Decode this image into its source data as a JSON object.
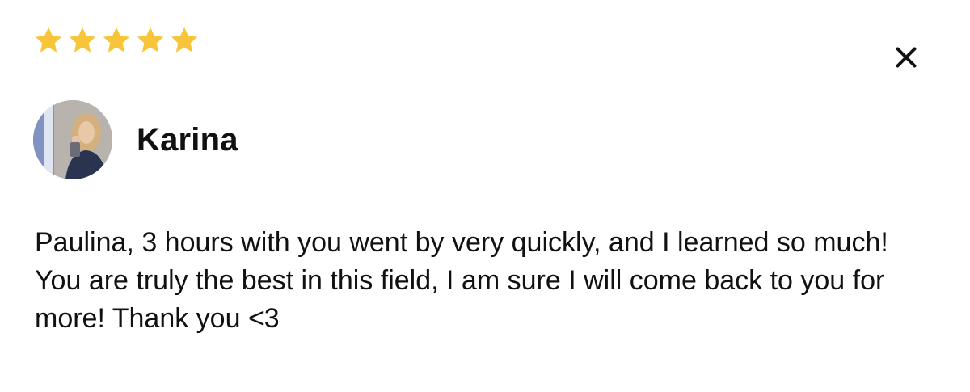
{
  "rating": {
    "stars": 5,
    "max": 5,
    "star_color": "#F8C53A",
    "icon": "star-icon"
  },
  "close": {
    "icon": "close-icon"
  },
  "reviewer": {
    "name": "Karina",
    "avatar_icon": "avatar-photo"
  },
  "review": {
    "text": "Paulina, 3 hours with you went by very quickly, and I learned so much! You are truly the best in this field, I am sure I will come back to you for more! Thank you <3"
  }
}
